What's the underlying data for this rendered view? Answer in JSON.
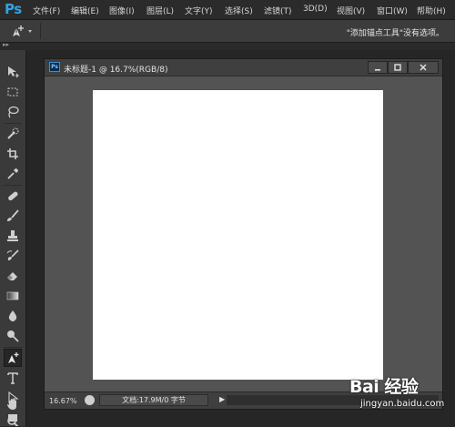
{
  "app": {
    "logo": "Ps"
  },
  "menu": [
    "文件(F)",
    "编辑(E)",
    "图像(I)",
    "图层(L)",
    "文字(Y)",
    "选择(S)",
    "滤镜(T)",
    "3D(D)",
    "视图(V)",
    "窗口(W)",
    "帮助(H)"
  ],
  "options_bar": {
    "tool_icon": "pen-add-icon",
    "message": "\"添加锚点工具\"没有选项。"
  },
  "tools": [
    {
      "name": "move-tool",
      "icon": "move-icon"
    },
    {
      "name": "marquee-tool",
      "icon": "marquee-icon"
    },
    {
      "name": "lasso-tool",
      "icon": "lasso-icon"
    },
    {
      "name": "quick-select-tool",
      "icon": "quick-select-icon"
    },
    {
      "name": "crop-tool",
      "icon": "crop-icon"
    },
    {
      "name": "eyedropper-tool",
      "icon": "eyedropper-icon"
    },
    {
      "name": "healing-tool",
      "icon": "bandage-icon"
    },
    {
      "name": "brush-tool",
      "icon": "brush-icon"
    },
    {
      "name": "stamp-tool",
      "icon": "stamp-icon"
    },
    {
      "name": "history-brush-tool",
      "icon": "history-brush-icon"
    },
    {
      "name": "eraser-tool",
      "icon": "eraser-icon"
    },
    {
      "name": "gradient-tool",
      "icon": "gradient-icon"
    },
    {
      "name": "blur-tool",
      "icon": "blur-drop-icon"
    },
    {
      "name": "dodge-tool",
      "icon": "dodge-icon"
    },
    {
      "name": "pen-tool",
      "icon": "pen-add-icon",
      "active": true
    },
    {
      "name": "type-tool",
      "icon": "type-icon"
    },
    {
      "name": "path-select-tool",
      "icon": "path-select-icon"
    },
    {
      "name": "shape-tool",
      "icon": "rectangle-icon"
    },
    {
      "name": "hand-tool",
      "icon": "hand-icon"
    },
    {
      "name": "zoom-tool",
      "icon": "zoom-icon"
    }
  ],
  "document": {
    "title": "未标题-1 @ 16.7%(RGB/8)",
    "ps_badge": "Ps",
    "zoom": "16.67%",
    "info": "文档:17.9M/0 字节",
    "canvas_color": "#ffffff"
  },
  "watermark": {
    "brand": "Bai 经验",
    "url": "jingyan.baidu.com"
  },
  "colors": {
    "accent": "#2fa3e6",
    "panel": "#3a3a3a",
    "workspace": "#535353"
  }
}
